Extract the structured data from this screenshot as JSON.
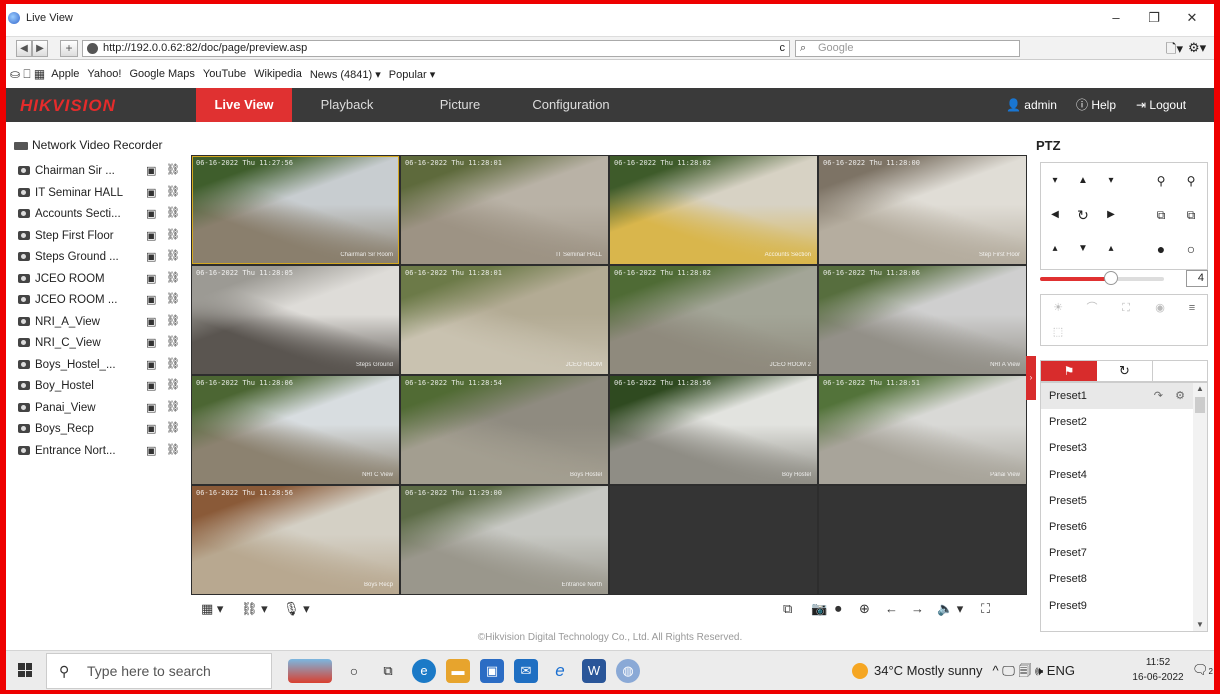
{
  "window": {
    "title": "Live View",
    "minimize": "–",
    "restore": "❐",
    "close": "✕"
  },
  "nav": {
    "back": "◀",
    "forward": "▶",
    "add": "+",
    "url": "http://192.0.0.62:82/doc/page/preview.asp",
    "reload": "c",
    "search_placeholder": "Google",
    "page_menu": "🗋▾",
    "tools_menu": "⚙▾"
  },
  "bookmarks": [
    "Apple",
    "Yahoo!",
    "Google Maps",
    "YouTube",
    "Wikipedia",
    "News (4841) ▾",
    "Popular ▾"
  ],
  "app": {
    "brand": "HIKVISION",
    "tabs": [
      "Live View",
      "Playback",
      "Picture",
      "Configuration"
    ],
    "user": "admin",
    "help": "Help",
    "logout": "Logout"
  },
  "tree": {
    "root": "Network Video Recorder",
    "cameras": [
      "Chairman Sir ...",
      "IT Seminar HALL",
      "Accounts Secti...",
      "Step First Floor",
      "Steps Ground ...",
      "JCEO ROOM",
      "JCEO ROOM ...",
      "NRI_A_View",
      "NRI_C_View",
      "Boys_Hostel_...",
      "Boy_Hostel",
      "Panai_View",
      "Boys_Recp",
      "Entrance Nort..."
    ]
  },
  "grid": {
    "selected_index": 0,
    "tiles": [
      {
        "ts": "06-16-2022 Thu 11:27:56",
        "cap": "Chairman Sir Room",
        "colors": [
          "#c8cdd0",
          "#3f5e2c",
          "#8a7f6d"
        ]
      },
      {
        "ts": "06-16-2022 Thu 11:28:01",
        "cap": "IT Seminar HALL",
        "colors": [
          "#b9b2a6",
          "#5e6a3c",
          "#9d9384"
        ]
      },
      {
        "ts": "06-16-2022 Thu 11:28:02",
        "cap": "Accounts Section",
        "colors": [
          "#d7d2c4",
          "#3e5b2a",
          "#d9b64c"
        ]
      },
      {
        "ts": "06-16-2022 Thu 11:28:00",
        "cap": "Step First Floor",
        "colors": [
          "#e0ddd6",
          "#7d7365",
          "#b5ad9f"
        ]
      },
      {
        "ts": "06-16-2022 Thu 11:28:05",
        "cap": "Steps Ground",
        "colors": [
          "#dedcd8",
          "#9c9a94",
          "#5a5550"
        ]
      },
      {
        "ts": "06-16-2022 Thu 11:28:01",
        "cap": "JCEO ROOM",
        "colors": [
          "#b3ab94",
          "#6c7a48",
          "#c9c2b0"
        ]
      },
      {
        "ts": "06-16-2022 Thu 11:28:02",
        "cap": "JCEO ROOM 2",
        "colors": [
          "#a3a597",
          "#4f6b35",
          "#8f8a7d"
        ]
      },
      {
        "ts": "06-16-2022 Thu 11:28:06",
        "cap": "NRI A View",
        "colors": [
          "#cfcfcf",
          "#576e3e",
          "#939088"
        ]
      },
      {
        "ts": "06-16-2022 Thu 11:28:06",
        "cap": "NRI C View",
        "colors": [
          "#d8dde0",
          "#4c6633",
          "#8c8270"
        ]
      },
      {
        "ts": "06-16-2022 Thu 11:28:54",
        "cap": "Boys Hostel",
        "colors": [
          "#8f8b80",
          "#516b34",
          "#a39e90"
        ]
      },
      {
        "ts": "06-16-2022 Thu 11:28:56",
        "cap": "Boy Hostel",
        "colors": [
          "#e2e3df",
          "#2f4a20",
          "#8f8d85"
        ]
      },
      {
        "ts": "06-16-2022 Thu 11:28:51",
        "cap": "Panai View",
        "colors": [
          "#d9d9d6",
          "#53733a",
          "#a8a49a"
        ]
      },
      {
        "ts": "06-16-2022 Thu 11:28:56",
        "cap": "Boys Recp",
        "colors": [
          "#d4d0c5",
          "#8a5a38",
          "#b8a890"
        ]
      },
      {
        "ts": "06-16-2022 Thu 11:29:00",
        "cap": "Entrance North",
        "colors": [
          "#c7c8c3",
          "#5c6b46",
          "#9a978c"
        ]
      },
      {
        "ts": "",
        "cap": "",
        "colors": []
      },
      {
        "ts": "",
        "cap": "",
        "colors": []
      }
    ]
  },
  "toolbar": {
    "layout": "▦ ▾",
    "stream": "⛓ ▾",
    "mic": "🎙 ▾",
    "right": [
      "⧉",
      "📷",
      "⏺",
      "⊕",
      "←",
      "→",
      "🔈 ▾",
      "⛶"
    ]
  },
  "copyright": "©Hikvision Digital Technology Co., Ltd. All Rights Reserved.",
  "ptz": {
    "title": "PTZ",
    "speed": "4",
    "speed_fraction": 0.57,
    "tab_preset": "⚑",
    "tab_patrol": "↻",
    "presets": [
      "Preset1",
      "Preset2",
      "Preset3",
      "Preset4",
      "Preset5",
      "Preset6",
      "Preset7",
      "Preset8",
      "Preset9"
    ]
  },
  "taskbar": {
    "search": "Type here to search",
    "weather": "34°C  Mostly sunny",
    "tray": "^ 🖵 🗐 🕪 ENG",
    "time": "11:52",
    "date": "16-06-2022",
    "notifications": "2"
  },
  "colors": {
    "accent": "#e03131",
    "header": "#3a3a3a",
    "frame": "#e00000"
  }
}
